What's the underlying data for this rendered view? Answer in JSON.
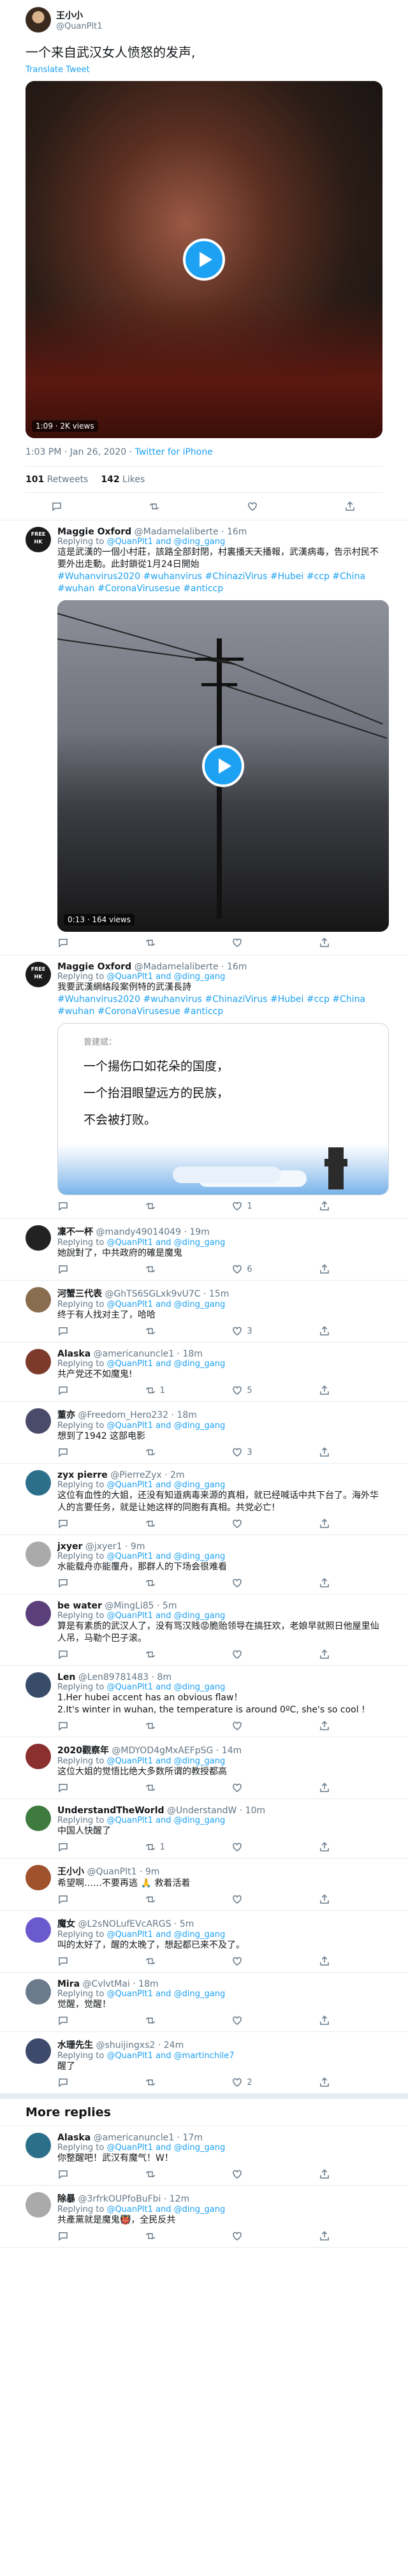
{
  "main_tweet": {
    "name": "王小小",
    "handle": "@QuanPlt1",
    "text": "一个来自武汉女人愤怒的发声,",
    "translate": "Translate Tweet",
    "video_views": "1:09 · 2K views",
    "time": "1:03 PM · Jan 26, 2020",
    "source": "Twitter for iPhone",
    "retweets": "101",
    "retweets_label": "Retweets",
    "likes": "142",
    "likes_label": "Likes"
  },
  "replies": [
    {
      "name": "Maggie Oxford",
      "handle": "@Madamelaliberte",
      "time": "· 16m",
      "replying_prefix": "Replying to",
      "replying": "@QuanPlt1 and @ding_gang",
      "text": "這是武漢的一個小村莊，該路全部封閉，村裏播天天播報，武漢病毒，告示村民不要外出走動。此封鎖從1月24日開始",
      "tags": "#Wuhanvirus2020 #wuhanvirus #ChinaziVirus #Hubei #ccp #China #wuhan #CoronaVirusesue #anticcp",
      "video_views": "0:13 · 164 views",
      "likes": "",
      "retweets": ""
    },
    {
      "name": "Maggie Oxford",
      "handle": "@Madamelaliberte",
      "time": "· 16m",
      "replying_prefix": "Replying to",
      "replying": "@QuanPlt1 and @ding_gang",
      "text": "我要武漢網絡段案例特的武漢長詩",
      "tags": "#Wuhanvirus2020 #wuhanvirus #ChinaziVirus #Hubei #ccp #China #wuhan #CoronaVirusesue #anticcp",
      "poem_author": "曾建斌：",
      "poem_lines": [
        "一个揚伤口如花朵的国度，",
        "一个抬泪眼望远方的民族，",
        "不会被打败。"
      ],
      "likes": "1",
      "retweets": ""
    },
    {
      "name": "凜不一杯",
      "handle": "@mandy49014049",
      "time": "· 19m",
      "replying_prefix": "Replying to",
      "replying": "@QuanPlt1 and @ding_gang",
      "text": "她說對了，中共政府的確是魔鬼",
      "likes": "6",
      "retweets": ""
    },
    {
      "name": "河蟹三代表",
      "handle": "@GhTS6SGLxk9vU7C",
      "time": "· 15m",
      "replying_prefix": "Replying to",
      "replying": "@QuanPlt1 and @ding_gang",
      "text": "终于有人找对主了，哈哈",
      "likes": "3",
      "retweets": ""
    },
    {
      "name": "Alaska",
      "handle": "@americanuncle1",
      "time": "· 18m",
      "replying_prefix": "Replying to",
      "replying": "@QuanPlt1 and @ding_gang",
      "text": "共产党还不如魔鬼!",
      "likes": "5",
      "retweets": "1"
    },
    {
      "name": "董亦",
      "handle": "@Freedom_Hero232",
      "time": "· 18m",
      "replying_prefix": "Replying to",
      "replying": "@QuanPlt1 and @ding_gang",
      "text": "想到了1942 这部电影",
      "likes": "3",
      "retweets": ""
    },
    {
      "name": "zyx pierre",
      "handle": "@PierreZyx",
      "time": "· 2m",
      "replying_prefix": "Replying to",
      "replying": "@QuanPlt1 and @ding_gang",
      "text": "这位有血性的大姐，还没有知道病毒来源的真相，就已经喊话中共下台了。海外华人的言要任务，就是让她这样的同胞有真相。共党必亡!",
      "likes": "",
      "retweets": ""
    },
    {
      "name": "jxyer",
      "handle": "@jxyer1",
      "time": "· 9m",
      "replying_prefix": "Replying to",
      "replying": "@QuanPlt1 and @ding_gang",
      "text": "水能载舟亦能覆舟，那群人的下场会很难看",
      "likes": "",
      "retweets": ""
    },
    {
      "name": "be water",
      "handle": "@MingLi85",
      "time": "· 5m",
      "replying_prefix": "Replying to",
      "replying": "@QuanPlt1 and @ding_gang",
      "text": "算是有素质的武汉人了，没有骂汉贱😡脆贻领导在搞狂欢，老娘早就照日他屋里仙人吊，马勒个巴子滚。",
      "likes": "",
      "retweets": ""
    },
    {
      "name": "Len",
      "handle": "@Len89781483",
      "time": "· 8m",
      "replying_prefix": "Replying to",
      "replying": "@QuanPlt1 and @ding_gang",
      "text": "1.Her hubei accent has an obvious flaw！\n2.It's winter in wuhan, the temperature is around 0ºC, she's so cool !",
      "likes": "",
      "retweets": ""
    },
    {
      "name": "2020觀察年",
      "handle": "@MDYOD4gMxAEFpSG",
      "time": "· 14m",
      "replying_prefix": "Replying to",
      "replying": "@QuanPlt1 and @ding_gang",
      "text": "这位大姐的觉悟比绝大多数所谓的教授都高",
      "likes": "",
      "retweets": ""
    },
    {
      "name": "UnderstandTheWorld",
      "handle": "@UnderstandW",
      "time": "· 10m",
      "replying_prefix": "Replying to",
      "replying": "@QuanPlt1 and @ding_gang",
      "text": "中国人快醒了",
      "likes": "",
      "retweets": "1"
    },
    {
      "name": "王小小",
      "handle": "@QuanPlt1",
      "time": "· 9m",
      "replying_prefix": "",
      "replying": "",
      "text": "希望啊……不要再逃 🙏 救着活着",
      "likes": "",
      "retweets": ""
    },
    {
      "name": "魔女",
      "handle": "@L2sNOLufEVcARGS",
      "time": "· 5m",
      "replying_prefix": "Replying to",
      "replying": "@QuanPlt1 and @ding_gang",
      "text": "叫的太好了，醒的太晚了，想起都已来不及了。",
      "likes": "",
      "retweets": ""
    },
    {
      "name": "Mira",
      "handle": "@CvlvtMai",
      "time": "· 18m",
      "replying_prefix": "Replying to",
      "replying": "@QuanPlt1 and @ding_gang",
      "text": "觉醒，觉醒！",
      "likes": "",
      "retweets": ""
    },
    {
      "name": "水珊先生",
      "handle": "@shuijingxs2",
      "time": "· 24m",
      "replying_prefix": "Replying to",
      "replying": "@QuanPlt1 and @martinchile7",
      "text": "醒了",
      "likes": "2",
      "retweets": ""
    }
  ],
  "more_replies_title": "More replies",
  "more_replies": [
    {
      "name": "Alaska",
      "handle": "@americanuncle1",
      "time": "· 17m",
      "replying_prefix": "Replying to",
      "replying": "@QuanPlt1 and @ding_gang",
      "text": "你整醒吧！武汉有魔气！W！"
    },
    {
      "name": "除暴",
      "handle": "@3rfrkOUPfoBuFbi",
      "time": "· 12m",
      "replying_prefix": "Replying to",
      "replying": "@QuanPlt1 and @ding_gang",
      "text": "共產黨就是魔鬼👹，全民反共"
    }
  ],
  "colors": {
    "accent": "#1da1f2",
    "muted": "#657786",
    "divider": "#e6ecf0",
    "like_red": "#e0245e"
  }
}
